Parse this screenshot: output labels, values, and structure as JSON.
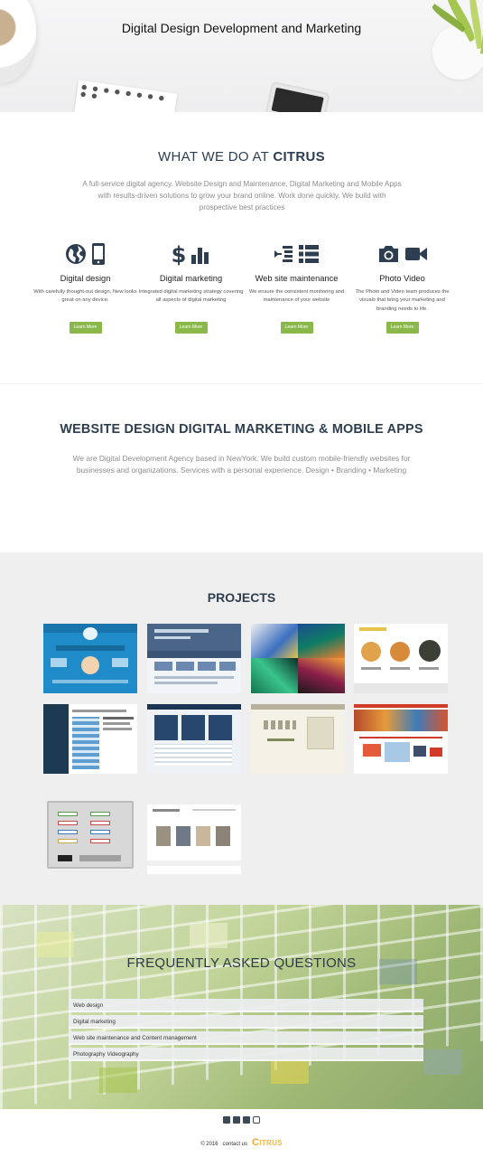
{
  "hero": {
    "title": "Digital Design Development and Marketing"
  },
  "what": {
    "heading_prefix": "WHAT WE DO AT ",
    "heading_brand": "CITRUS",
    "intro": "A full-service digital agency. Website Design and Maintenance, Digital Marketing and Mobile Apps with results-driven solutions to grow your brand online. Work done quickly. We build with prospective best practices",
    "services": [
      {
        "name": "Digital design",
        "desc": "With carefully thought-out design, New looks great on any device.",
        "button": "Learn More",
        "icons": [
          "globe-icon",
          "mobile-icon"
        ]
      },
      {
        "name": "Digital marketing",
        "desc": "Integrated digital marketing strategy covering all aspects of digital marketing",
        "button": "Learn More",
        "icons": [
          "dollar-icon",
          "bar-chart-icon"
        ]
      },
      {
        "name": "Web site maintenance",
        "desc": "We ensure the consistent monitoring and maintenance of your website",
        "button": "Learn More",
        "icons": [
          "indent-icon",
          "list-icon"
        ]
      },
      {
        "name": "Photo  Video",
        "desc": "The Photo and Video team produces the visuals that bring your marketing and branding needs to life.",
        "button": "Learn More",
        "icons": [
          "camera-icon",
          "video-icon"
        ]
      }
    ]
  },
  "website_design": {
    "heading": "WEBSITE DESIGN DIGITAL MARKETING & MOBILE APPS",
    "text": "We are Digital Development Agency based in NewYork. We build custom mobile-friendly websites for businesses and organizations. Services with a personal experience. Design • Branding • Marketing"
  },
  "projects": {
    "heading": "PROJECTS"
  },
  "faq": {
    "heading": "FREQUENTLY ASKED QUESTIONS",
    "items": [
      "Web design",
      "Digital marketing",
      "Web site maintenance and Content management",
      "Photography Videography"
    ]
  },
  "footer": {
    "socials": [
      "twitter-icon",
      "facebook-icon",
      "pinterest-icon",
      "instagram-icon"
    ],
    "copyright": "© 2016",
    "contact": "contact us",
    "logo": "ITRUS",
    "logo_c": "C"
  },
  "colors": {
    "accent": "#8bb84a",
    "heading": "#2d3e50",
    "muted": "#8d8d8d",
    "brand": "#f3b63f"
  }
}
